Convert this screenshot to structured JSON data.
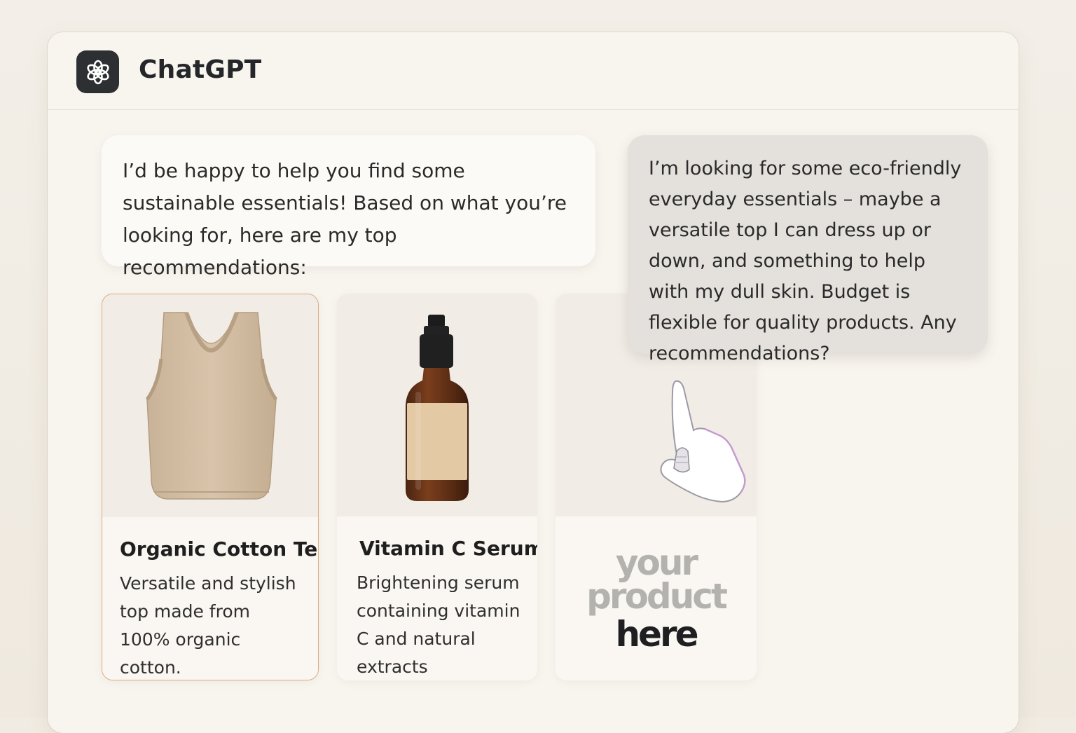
{
  "app": {
    "title": "ChatGPT",
    "logo_icon": "openai-logo-icon"
  },
  "chat": {
    "assistant_message": "I’d be happy to help you find some sustainable essentials! Based on what you’re looking for, here are my top recommendations:",
    "user_message": "I’m looking for some eco-friendly everyday essentials – maybe a versatile top I can dress up or down, and something to help with my dull skin. Budget is flexible for quality products. Any recommendations?"
  },
  "products": [
    {
      "title": "Organic Cotton Tee",
      "description": "Versatile and stylish top made from 100% organic cotton.",
      "image_icon": "tank-top-icon",
      "highlighted": true
    },
    {
      "title": "Vitamin C Serum",
      "description": "Brightening serum containing vitamin C and natural extracts",
      "image_icon": "serum-bottle-icon"
    },
    {
      "placeholder_line_1": "your",
      "placeholder_line_2": "product",
      "placeholder_line_3": "here"
    }
  ],
  "cursor": {
    "icon": "pointing-hand-cursor-icon"
  },
  "colors": {
    "background": "#f1ece3",
    "window": "#f8f5ef",
    "logo_bg": "#2e2f33",
    "user_bubble": "#e4e1dc",
    "highlight_border": "#d9ab83"
  }
}
